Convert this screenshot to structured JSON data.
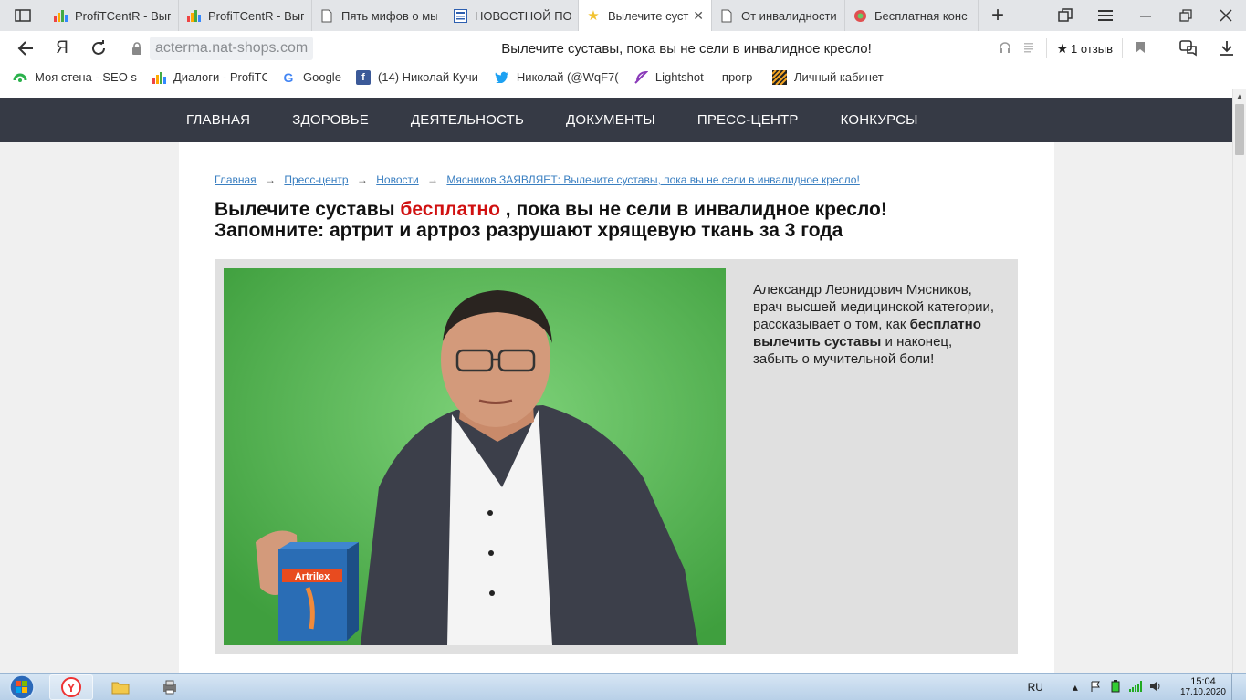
{
  "browser": {
    "tabs": [
      {
        "title": "ProfiTCentR - Вып",
        "icon": "bar-chart-icon"
      },
      {
        "title": "ProfiTCentR - Вып",
        "icon": "bar-chart-icon"
      },
      {
        "title": "Пять мифов о мы",
        "icon": "document-icon"
      },
      {
        "title": "НОВОСТНОЙ ПО",
        "icon": "news-icon"
      },
      {
        "title": "Вылечите суст",
        "icon": "star-icon",
        "active": true
      },
      {
        "title": "От инвалидности",
        "icon": "document-icon"
      },
      {
        "title": "Бесплатная конс",
        "icon": "flower-icon"
      }
    ],
    "address": {
      "domain": "acterma.nat-shops.com",
      "page_title": "Вылечите суставы, пока вы не сели в инвалидное кресло!",
      "reviews_label": "1 отзыв",
      "ya_label": "Я"
    },
    "bookmarks": [
      {
        "label": "Моя стена - SEO s",
        "icon": "vk-icon"
      },
      {
        "label": "Диалоги - ProfiTCe",
        "icon": "bar-chart-icon"
      },
      {
        "label": "Google",
        "icon": "google-icon"
      },
      {
        "label": "(14) Николай Кучи",
        "icon": "facebook-icon"
      },
      {
        "label": "Николай (@WqF7(",
        "icon": "twitter-icon"
      },
      {
        "label": "Lightshot — прогр",
        "icon": "feather-icon"
      },
      {
        "label": "Личный кабинет",
        "icon": "striped-icon"
      }
    ]
  },
  "site": {
    "nav": [
      "ГЛАВНАЯ",
      "ЗДОРОВЬЕ",
      "ДЕЯТЕЛЬНОСТЬ",
      "ДОКУМЕНТЫ",
      "ПРЕСС-ЦЕНТР",
      "КОНКУРСЫ"
    ],
    "breadcrumb": {
      "items": [
        "Главная",
        "Пресс-центр",
        "Новости",
        "Мясников ЗАЯВЛЯЕТ: Вылечите суставы, пока вы не сели в инвалидное кресло!"
      ],
      "separator": "→"
    },
    "headline": {
      "part1": "Вылечите суставы ",
      "highlight": "бесплатно",
      "part2": " , пока вы не сели в инвалидное кресло!",
      "line2": "Запомните: артрит и артроз разрушают хрящевую ткань за 3 года"
    },
    "lead": {
      "text1": "Александр Леонидович Мясников, врач высшей медицинской категории, рассказывает о том, как ",
      "bold": "бесплатно вылечить суставы",
      "text2": " и наконец, забыть о мучительной боли!"
    },
    "photo": {
      "product_label": "Artrilex",
      "colors": {
        "background": "#54b848",
        "jacket": "#3c3f4a",
        "shirt": "#f4f4f4",
        "box": "#2a6db5"
      }
    }
  },
  "taskbar": {
    "lang": "RU",
    "time": "15:04",
    "date": "17.10.2020"
  },
  "colors": {
    "nav_bg": "#363a45",
    "highlight_red": "#d01010",
    "link_blue": "#3a7fc1"
  }
}
